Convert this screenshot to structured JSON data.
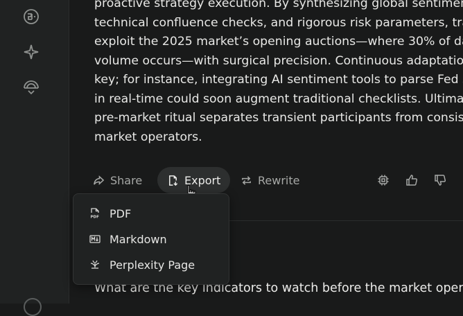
{
  "sidebar": {
    "icons": [
      "library-icon",
      "discover-icon",
      "spaces-icon"
    ]
  },
  "answer": {
    "lines": [
      "proactive strategy execution. By synthesizing global sentimen",
      "technical confluence checks, and rigorous risk parameters, tra",
      "exploit the 2025 market’s opening auctions—where 30% of da",
      "volume occurs—with surgical precision. Continuous adaptatio",
      "key; for instance, integrating AI sentiment tools to parse Fed s",
      "in real-time could soon augment traditional checklists. Ultima",
      "pre-market ritual separates transient participants from consis",
      "market operators."
    ]
  },
  "actions": {
    "share_label": "Share",
    "export_label": "Export",
    "rewrite_label": "Rewrite"
  },
  "export_menu": {
    "items": [
      {
        "label": "PDF",
        "icon": "pdf-icon"
      },
      {
        "label": "Markdown",
        "icon": "markdown-icon"
      },
      {
        "label": "Perplexity Page",
        "icon": "perplexity-page-icon"
      }
    ]
  },
  "followup": {
    "question": "What are the key indicators to watch before the market oper"
  },
  "colors": {
    "background": "#191a1a",
    "sidebar": "#202222",
    "text": "#e8e8e6",
    "muted": "#a6a8a6"
  }
}
